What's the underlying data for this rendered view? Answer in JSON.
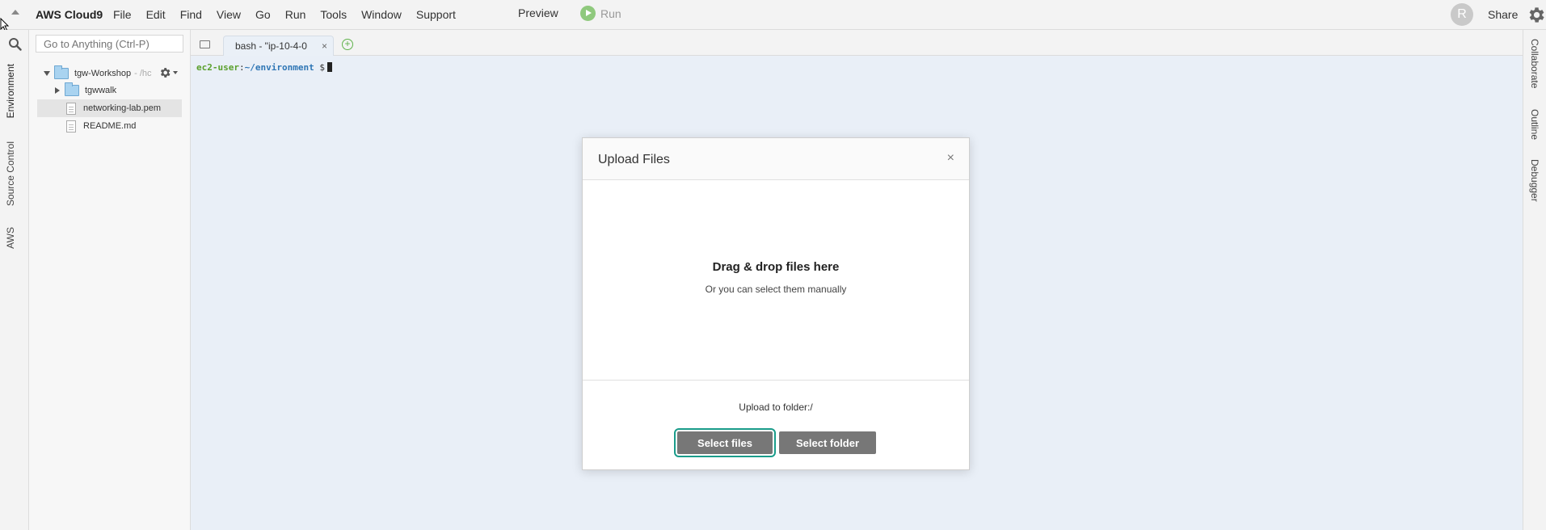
{
  "menubar": {
    "brand": "AWS Cloud9",
    "menu_items": [
      "File",
      "Edit",
      "Find",
      "View",
      "Go",
      "Run",
      "Tools",
      "Window",
      "Support"
    ],
    "preview_label": "Preview",
    "run_label": "Run",
    "avatar_initial": "R",
    "share_label": "Share"
  },
  "left_tabs": [
    "Environment",
    "Source Control",
    "AWS"
  ],
  "right_tabs": [
    "Collaborate",
    "Outline",
    "Debugger"
  ],
  "tree": {
    "search_placeholder": "Go to Anything (Ctrl-P)",
    "root_name": "tgw-Workshop",
    "root_suffix": "- /hc",
    "items": [
      {
        "name": "tgwwalk",
        "type": "folder"
      },
      {
        "name": "networking-lab.pem",
        "type": "file"
      },
      {
        "name": "README.md",
        "type": "file"
      }
    ]
  },
  "editor": {
    "tab_label": "bash - \"ip-10-4-0",
    "tab_close": "×",
    "add_tab": "+",
    "prompt_user": "ec2-user",
    "prompt_sep": ":",
    "prompt_path": "~/environment",
    "prompt_dollar": "$"
  },
  "modal": {
    "title": "Upload Files",
    "close": "×",
    "drop_title": "Drag & drop files here",
    "drop_subtitle": "Or you can select them manually",
    "upload_to": "Upload to folder:/",
    "select_files": "Select files",
    "select_folder": "Select folder"
  },
  "colors": {
    "accent_focus": "#1a9c8a",
    "terminal_bg": "#e9eff7",
    "prompt_user": "#5aa02c",
    "prompt_path": "#2f76b5"
  }
}
